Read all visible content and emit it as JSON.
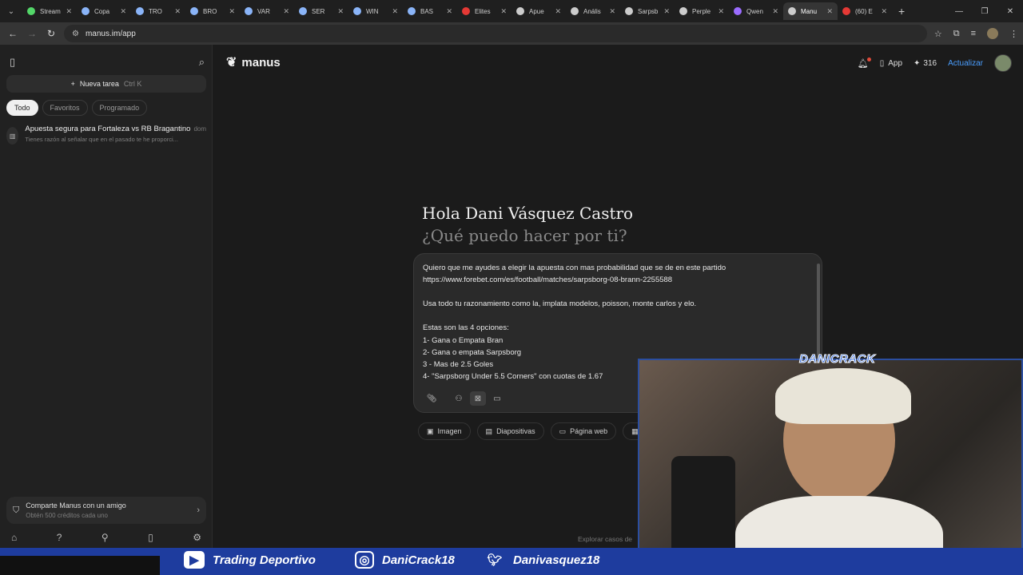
{
  "browser": {
    "tabs": [
      {
        "label": "Stream",
        "color": "#53d769"
      },
      {
        "label": "Copa",
        "color": "#8ab4f8"
      },
      {
        "label": "TRO",
        "color": "#8ab4f8"
      },
      {
        "label": "BRO",
        "color": "#8ab4f8"
      },
      {
        "label": "VAR",
        "color": "#8ab4f8"
      },
      {
        "label": "SER",
        "color": "#8ab4f8"
      },
      {
        "label": "WIN",
        "color": "#8ab4f8"
      },
      {
        "label": "BAS",
        "color": "#8ab4f8"
      },
      {
        "label": "Elites",
        "color": "#e53935"
      },
      {
        "label": "Apue",
        "color": "#cccccc"
      },
      {
        "label": "Anális",
        "color": "#cccccc"
      },
      {
        "label": "Sarpsb",
        "color": "#cccccc"
      },
      {
        "label": "Perple",
        "color": "#cccccc"
      },
      {
        "label": "Qwen",
        "color": "#9b6cff"
      },
      {
        "label": "Manu",
        "color": "#cccccc",
        "active": true
      },
      {
        "label": "(60) E",
        "color": "#e53935"
      }
    ],
    "url": "manus.im/app"
  },
  "sidebar": {
    "new_task_label": "Nueva tarea",
    "new_task_shortcut": "Ctrl  K",
    "filters": [
      "Todo",
      "Favoritos",
      "Programado"
    ],
    "tasks": [
      {
        "title": "Apuesta segura para Fortaleza vs RB Bragantino",
        "when": "dom",
        "subtitle": "Tienes razón al señalar que en el pasado te he proporci..."
      }
    ],
    "share": {
      "title": "Comparte Manus con un amigo",
      "subtitle": "Obtén 500 créditos cada uno"
    }
  },
  "header": {
    "brand": "manus",
    "app_label": "App",
    "credits": "316",
    "upgrade_label": "Actualizar"
  },
  "main": {
    "greeting": "Hola Dani Vásquez Castro",
    "subgreeting": "¿Qué puedo hacer por ti?",
    "prompt": "Quiero que me ayudes a elegir la apuesta con mas probabilidad que se de en este partido\nhttps://www.forebet.com/es/football/matches/sarpsborg-08-brann-2255588\n\nUsa todo tu razonamiento como la, implata modelos, poisson, monte carlos y elo.\n\nEstas son las 4 opciones:\n1- Gana o Empata Bran\n2- Gana o empata Sarpsborg\n3 - Mas de 2.5 Goles\n4- \"Sarpsborg Under 5.5 Corners\" con cuotas de 1.67",
    "suggestions": [
      "Imagen",
      "Diapositivas",
      "Página web",
      "H"
    ],
    "explore": "Explorar casos de"
  },
  "overlay": {
    "cam_label": "DANICRACK",
    "social": [
      {
        "icon": "youtube-icon",
        "label": "Trading Deportivo"
      },
      {
        "icon": "instagram-icon",
        "label": "DaniCrack18"
      },
      {
        "icon": "twitter-icon",
        "label": "Danivasquez18"
      }
    ]
  }
}
